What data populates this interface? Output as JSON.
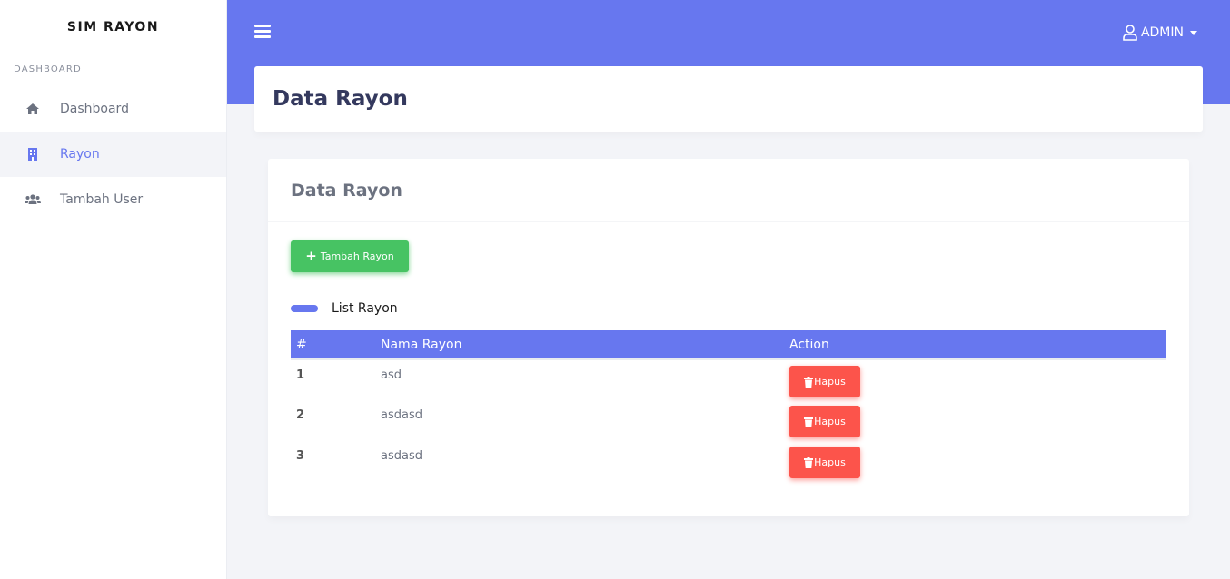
{
  "app": {
    "brand": "SIM RAYON"
  },
  "sidebar": {
    "heading": "DASHBOARD",
    "items": [
      {
        "label": "Dashboard",
        "icon": "home-icon",
        "active": false
      },
      {
        "label": "Rayon",
        "icon": "building-icon",
        "active": true
      },
      {
        "label": "Tambah User",
        "icon": "users-icon",
        "active": false
      }
    ]
  },
  "topbar": {
    "user_label": "ADMIN"
  },
  "page": {
    "title": "Data Rayon"
  },
  "card": {
    "title": "Data Rayon",
    "add_button_label": "Tambah Rayon",
    "section_title": "List Rayon"
  },
  "table": {
    "columns": [
      "#",
      "Nama Rayon",
      "Action"
    ],
    "rows": [
      {
        "num": "1",
        "name": "asd",
        "action": "Hapus"
      },
      {
        "num": "2",
        "name": "asdasd",
        "action": "Hapus"
      },
      {
        "num": "3",
        "name": "asdasd",
        "action": "Hapus"
      }
    ]
  },
  "colors": {
    "primary": "#6777ef",
    "success": "#47c363",
    "danger": "#fc544b",
    "background": "#f3f4f8"
  }
}
